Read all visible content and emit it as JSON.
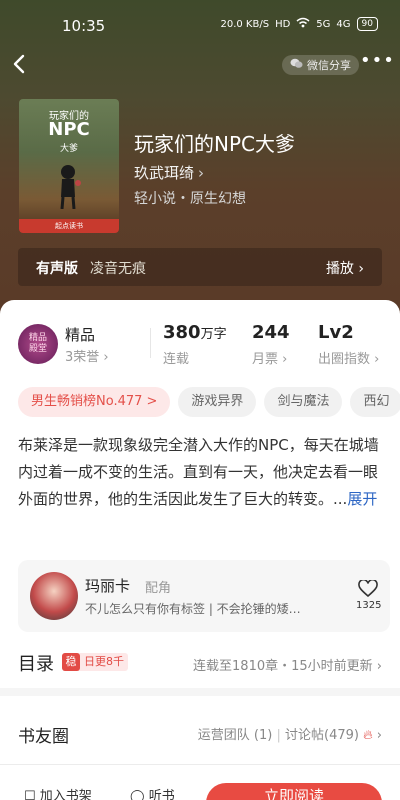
{
  "status_bar": {
    "time": "10:35",
    "net_speed": "20.0 KB/S",
    "hd": "HD",
    "signal_a": "5G",
    "signal_b": "4G",
    "battery": "90"
  },
  "nav": {
    "share_label": "微信分享",
    "more": "•••"
  },
  "book": {
    "cover": {
      "line1": "玩家们的",
      "line2": "NPC",
      "line3": "大爹",
      "band": "起点读书"
    },
    "title": "玩家们的NPC大爹",
    "author": "玖武珥绮",
    "author_chevron": "›",
    "genre": "轻小说・原生幻想"
  },
  "audio": {
    "label": "有声版",
    "narrator": "凌音无痕",
    "action": "播放 ›"
  },
  "stats": {
    "badge_text": "精品\n殿堂",
    "honor_label": "精品",
    "honor_sub": "3荣誉 ›",
    "words_value": "380",
    "words_unit": "万字",
    "words_caption": "连载",
    "tickets_value": "244",
    "tickets_caption": "月票 ›",
    "level_value": "Lv2",
    "level_caption": "出圈指数 ›"
  },
  "tags": [
    "男生畅销榜No.477 >",
    "游戏异界",
    "剑与魔法",
    "西幻"
  ],
  "intro": {
    "text": "布莱泽是一款现象级完全潜入大作的NPC，每天在城墙内过着一成不变的生活。直到有一天，他决定去看一眼外面的世界，他的生活因此发生了巨大的转变。...",
    "expand": "展开"
  },
  "role": {
    "name": "玛丽卡",
    "type": "配角",
    "quote": "不儿怎么只有你有标签 | 不会抡锤的矮…",
    "likes": "1325"
  },
  "catalog": {
    "title": "目录",
    "badge_icon": "稳",
    "badge_text": "日更8千",
    "right": "连载至1810章・15小时前更新 ›"
  },
  "circle": {
    "title": "书友圈",
    "team": "运营团队 (1)",
    "sep": "|",
    "posts": "讨论帖(479)",
    "chevron": "›"
  },
  "bottom": {
    "shelf": "加入书架",
    "listen": "听书",
    "read": "立即阅读"
  },
  "colors": {
    "accent": "#e84b42",
    "link": "#2d66c4"
  }
}
